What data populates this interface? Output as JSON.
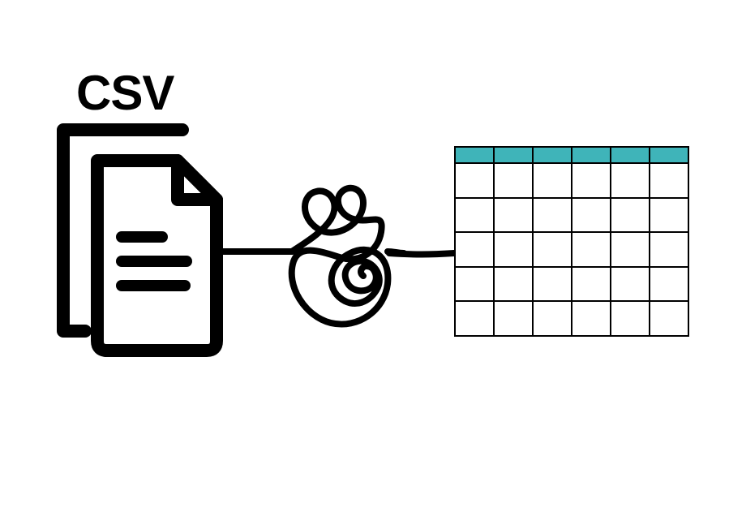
{
  "diagram": {
    "label": "CSV",
    "colors": {
      "stroke": "#000000",
      "table_header": "#3fb4b9",
      "background": "#ffffff"
    },
    "table": {
      "columns": 6,
      "rows": 5
    }
  }
}
